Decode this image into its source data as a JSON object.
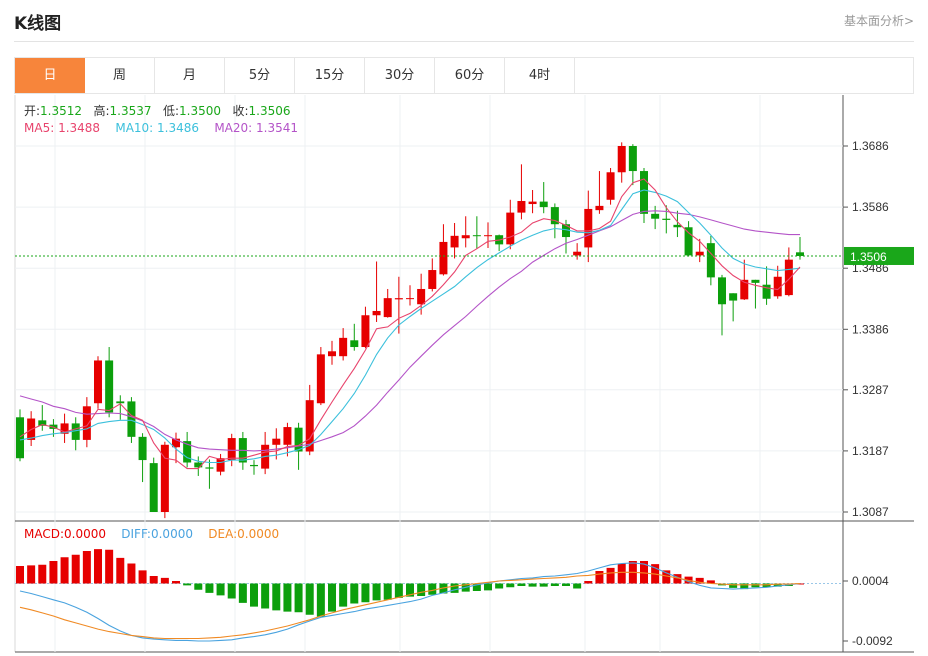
{
  "header": {
    "title": "K线图",
    "analysis_link": "基本面分析>"
  },
  "tabs": [
    {
      "label": "日",
      "active": true
    },
    {
      "label": "周"
    },
    {
      "label": "月"
    },
    {
      "label": "5分"
    },
    {
      "label": "15分"
    },
    {
      "label": "30分"
    },
    {
      "label": "60分"
    },
    {
      "label": "4时"
    }
  ],
  "ohlc_legend": {
    "open_label": "开:",
    "open": "1.3512",
    "high_label": "高:",
    "high": "1.3537",
    "low_label": "低:",
    "low": "1.3500",
    "close_label": "收:",
    "close": "1.3506"
  },
  "ma_legend": {
    "ma5_label": "MA5:",
    "ma5": "1.3488",
    "ma10_label": "MA10:",
    "ma10": "1.3486",
    "ma20_label": "MA20:",
    "ma20": "1.3541"
  },
  "macd_legend": {
    "macd_label": "MACD:",
    "macd": "0.0000",
    "diff_label": "DIFF:",
    "diff": "0.0000",
    "dea_label": "DEA:",
    "dea": "0.0000"
  },
  "colors": {
    "up": "#e60000",
    "down": "#0c9f0c",
    "ma5": "#e8446d",
    "ma10": "#3cc0dc",
    "ma20": "#b454c8",
    "diff": "#4aa3df",
    "dea": "#f08a24",
    "current": "#1aa71a",
    "accent": "#f7853b"
  },
  "chart_data": {
    "type": "candlestick",
    "price_axis": {
      "ticks": [
        "1.3686",
        "1.3586",
        "1.3486",
        "1.3386",
        "1.3287",
        "1.3187",
        "1.3087"
      ],
      "ylim": [
        1.3087,
        1.3686
      ]
    },
    "current_price": "1.3506",
    "candles": [
      [
        1.3242,
        1.3175,
        1.3255,
        1.317
      ],
      [
        1.3205,
        1.324,
        1.3252,
        1.3195
      ],
      [
        1.3237,
        1.3228,
        1.3262,
        1.322
      ],
      [
        1.323,
        1.3223,
        1.3239,
        1.321
      ],
      [
        1.3215,
        1.3232,
        1.3248,
        1.32
      ],
      [
        1.3232,
        1.3205,
        1.3242,
        1.3188
      ],
      [
        1.3205,
        1.326,
        1.3275,
        1.3193
      ],
      [
        1.3265,
        1.3335,
        1.3342,
        1.3256
      ],
      [
        1.3335,
        1.325,
        1.3357,
        1.3242
      ],
      [
        1.3268,
        1.3265,
        1.3278,
        1.3238
      ],
      [
        1.3268,
        1.321,
        1.3275,
        1.32
      ],
      [
        1.321,
        1.3172,
        1.3216,
        1.3136
      ],
      [
        1.3167,
        1.3087,
        1.3176,
        1.3087
      ],
      [
        1.3087,
        1.3197,
        1.3202,
        1.3077
      ],
      [
        1.3193,
        1.3207,
        1.3217,
        1.3167
      ],
      [
        1.3203,
        1.3168,
        1.3218,
        1.316
      ],
      [
        1.3168,
        1.316,
        1.3178,
        1.3146
      ],
      [
        1.316,
        1.3158,
        1.3173,
        1.3125
      ],
      [
        1.3153,
        1.3175,
        1.3182,
        1.3147
      ],
      [
        1.3172,
        1.3208,
        1.3215,
        1.3162
      ],
      [
        1.3208,
        1.3168,
        1.3218,
        1.3156
      ],
      [
        1.3164,
        1.3162,
        1.3172,
        1.3148
      ],
      [
        1.3158,
        1.3197,
        1.3218,
        1.3149
      ],
      [
        1.3197,
        1.3207,
        1.3224,
        1.3173
      ],
      [
        1.3197,
        1.3226,
        1.3233,
        1.3178
      ],
      [
        1.3225,
        1.3186,
        1.3233,
        1.3156
      ],
      [
        1.3186,
        1.327,
        1.3295,
        1.318
      ],
      [
        1.3265,
        1.3345,
        1.3357,
        1.3262
      ],
      [
        1.3342,
        1.335,
        1.3367,
        1.3328
      ],
      [
        1.3342,
        1.3372,
        1.3388,
        1.3335
      ],
      [
        1.3368,
        1.3357,
        1.3395,
        1.3351
      ],
      [
        1.3357,
        1.3409,
        1.3423,
        1.3355
      ],
      [
        1.3409,
        1.3416,
        1.3497,
        1.3398
      ],
      [
        1.3406,
        1.3437,
        1.3452,
        1.3405
      ],
      [
        1.3435,
        1.3437,
        1.3472,
        1.3379
      ],
      [
        1.3437,
        1.3437,
        1.3458,
        1.3425
      ],
      [
        1.3427,
        1.3452,
        1.3477,
        1.341
      ],
      [
        1.3452,
        1.3483,
        1.3502,
        1.3448
      ],
      [
        1.3476,
        1.3529,
        1.3558,
        1.3474
      ],
      [
        1.352,
        1.3539,
        1.356,
        1.3502
      ],
      [
        1.3535,
        1.354,
        1.3571,
        1.352
      ],
      [
        1.354,
        1.3539,
        1.3571,
        1.3518
      ],
      [
        1.3539,
        1.354,
        1.3561,
        1.3519
      ],
      [
        1.354,
        1.3525,
        1.3541,
        1.3514
      ],
      [
        1.3525,
        1.3577,
        1.3598,
        1.3517
      ],
      [
        1.3577,
        1.3596,
        1.3656,
        1.3566
      ],
      [
        1.3591,
        1.3595,
        1.3614,
        1.3576
      ],
      [
        1.3595,
        1.3586,
        1.3627,
        1.3576
      ],
      [
        1.3586,
        1.3558,
        1.3592,
        1.3535
      ],
      [
        1.3558,
        1.3537,
        1.3565,
        1.351
      ],
      [
        1.3507,
        1.3513,
        1.3527,
        1.35
      ],
      [
        1.352,
        1.3583,
        1.3613,
        1.3496
      ],
      [
        1.3581,
        1.3588,
        1.3645,
        1.3575
      ],
      [
        1.3598,
        1.3643,
        1.365,
        1.359
      ],
      [
        1.3643,
        1.3686,
        1.3692,
        1.3626
      ],
      [
        1.3686,
        1.3645,
        1.3689,
        1.3622
      ],
      [
        1.3645,
        1.3575,
        1.365,
        1.356
      ],
      [
        1.3575,
        1.3567,
        1.3588,
        1.355
      ],
      [
        1.3567,
        1.3565,
        1.3589,
        1.3543
      ],
      [
        1.3557,
        1.3553,
        1.358,
        1.3537
      ],
      [
        1.3553,
        1.3507,
        1.3563,
        1.3505
      ],
      [
        1.3507,
        1.3513,
        1.3534,
        1.3496
      ],
      [
        1.3527,
        1.3471,
        1.3539,
        1.3458
      ],
      [
        1.3471,
        1.3427,
        1.3475,
        1.3376
      ],
      [
        1.3445,
        1.3433,
        1.3445,
        1.3399
      ],
      [
        1.3435,
        1.3467,
        1.35,
        1.3434
      ],
      [
        1.3467,
        1.3462,
        1.3467,
        1.342
      ],
      [
        1.3459,
        1.3436,
        1.3489,
        1.3426
      ],
      [
        1.344,
        1.3472,
        1.349,
        1.3436
      ],
      [
        1.3442,
        1.35,
        1.352,
        1.344
      ],
      [
        1.3512,
        1.3506,
        1.3537,
        1.35
      ]
    ],
    "ma5": [
      1.321,
      1.3222,
      1.323,
      1.3226,
      1.3218,
      1.3223,
      1.3228,
      1.3255,
      1.3253,
      1.3264,
      1.3245,
      1.3237,
      1.32,
      1.3175,
      1.3172,
      1.3158,
      1.3158,
      1.3178,
      1.3173,
      1.3175,
      1.3175,
      1.318,
      1.3185,
      1.3187,
      1.3194,
      1.3196,
      1.3207,
      1.3238,
      1.3267,
      1.3295,
      1.3322,
      1.3352,
      1.3387,
      1.339,
      1.3404,
      1.3412,
      1.3425,
      1.344,
      1.3459,
      1.348,
      1.3507,
      1.3518,
      1.353,
      1.3532,
      1.3537,
      1.3545,
      1.356,
      1.3567,
      1.3564,
      1.3556,
      1.3547,
      1.3547,
      1.3551,
      1.3563,
      1.3603,
      1.3626,
      1.3632,
      1.3614,
      1.3585,
      1.3562,
      1.3544,
      1.353,
      1.351,
      1.349,
      1.3474,
      1.3463,
      1.3458,
      1.3454,
      1.3451,
      1.3468,
      1.3488
    ],
    "ma10": [
      1.3205,
      1.3208,
      1.3212,
      1.3215,
      1.3217,
      1.322,
      1.3223,
      1.3232,
      1.3235,
      1.3237,
      1.3237,
      1.323,
      1.3222,
      1.3208,
      1.319,
      1.3176,
      1.317,
      1.3168,
      1.3168,
      1.3172,
      1.3172,
      1.3174,
      1.3178,
      1.318,
      1.3184,
      1.3189,
      1.3196,
      1.3214,
      1.3235,
      1.3256,
      1.3281,
      1.3311,
      1.3345,
      1.3372,
      1.3393,
      1.3407,
      1.342,
      1.3432,
      1.3444,
      1.3456,
      1.3472,
      1.3487,
      1.35,
      1.3511,
      1.3522,
      1.3532,
      1.354,
      1.3547,
      1.3551,
      1.3549,
      1.3545,
      1.3544,
      1.3548,
      1.3556,
      1.3582,
      1.3608,
      1.3614,
      1.361,
      1.3604,
      1.3595,
      1.3577,
      1.356,
      1.354,
      1.3519,
      1.3502,
      1.3493,
      1.3488,
      1.3485,
      1.3482,
      1.3484,
      1.3486
    ],
    "ma20": [
      1.3277,
      1.3272,
      1.3267,
      1.326,
      1.3256,
      1.325,
      1.3247,
      1.3248,
      1.3249,
      1.3248,
      1.3243,
      1.3236,
      1.3227,
      1.3214,
      1.3205,
      1.3198,
      1.3192,
      1.319,
      1.3189,
      1.3188,
      1.3188,
      1.3187,
      1.3188,
      1.319,
      1.3192,
      1.3195,
      1.3198,
      1.3204,
      1.321,
      1.3217,
      1.3228,
      1.3244,
      1.3262,
      1.3283,
      1.3303,
      1.3324,
      1.3342,
      1.336,
      1.3377,
      1.3392,
      1.3407,
      1.3424,
      1.344,
      1.3455,
      1.3469,
      1.3481,
      1.3496,
      1.3507,
      1.3518,
      1.3527,
      1.3533,
      1.354,
      1.3547,
      1.3554,
      1.3564,
      1.3574,
      1.3579,
      1.358,
      1.3579,
      1.3576,
      1.3574,
      1.357,
      1.3565,
      1.356,
      1.3555,
      1.355,
      1.3547,
      1.3545,
      1.3543,
      1.3541,
      1.3541
    ],
    "macd_axis": {
      "ticks": [
        "0.0004",
        "-0.0092"
      ],
      "ylim": [
        -0.0092,
        0.0004
      ]
    },
    "macd_hist": [
      0.0028,
      0.0029,
      0.003,
      0.0036,
      0.0042,
      0.0046,
      0.0052,
      0.0055,
      0.0054,
      0.0041,
      0.0032,
      0.0021,
      0.0012,
      0.0009,
      0.0004,
      -0.0003,
      -0.001,
      -0.0015,
      -0.0019,
      -0.0024,
      -0.0031,
      -0.0037,
      -0.004,
      -0.0043,
      -0.0045,
      -0.0046,
      -0.005,
      -0.0053,
      -0.0045,
      -0.0037,
      -0.0032,
      -0.003,
      -0.0027,
      -0.0026,
      -0.0023,
      -0.0021,
      -0.002,
      -0.0018,
      -0.0016,
      -0.0015,
      -0.0013,
      -0.0012,
      -0.0011,
      -0.0008,
      -0.0006,
      -0.0004,
      -0.0005,
      -0.0005,
      -0.0004,
      -0.0004,
      -0.0008,
      0.0004,
      0.002,
      0.0025,
      0.0032,
      0.0036,
      0.0036,
      0.0031,
      0.0021,
      0.0015,
      0.0011,
      0.0009,
      0.0005,
      -0.0003,
      -0.0007,
      -0.0009,
      -0.0006,
      -0.0006,
      -0.0005,
      -0.0004,
      0.0
    ],
    "diff": [
      -0.0012,
      -0.0016,
      -0.0021,
      -0.0026,
      -0.0031,
      -0.0038,
      -0.0046,
      -0.0056,
      -0.0067,
      -0.0076,
      -0.0083,
      -0.0087,
      -0.0089,
      -0.009,
      -0.0091,
      -0.0091,
      -0.0092,
      -0.0092,
      -0.0091,
      -0.009,
      -0.0087,
      -0.0085,
      -0.0082,
      -0.0078,
      -0.0073,
      -0.0066,
      -0.006,
      -0.0054,
      -0.0051,
      -0.0048,
      -0.0045,
      -0.0041,
      -0.0038,
      -0.0035,
      -0.0032,
      -0.0029,
      -0.0025,
      -0.0019,
      -0.0015,
      -0.001,
      -0.0006,
      -0.0002,
      0.0001,
      0.0004,
      0.0006,
      0.0008,
      0.0009,
      0.0011,
      0.0012,
      0.0014,
      0.0016,
      0.002,
      0.0025,
      0.003,
      0.0032,
      0.0033,
      0.0031,
      0.0025,
      0.0017,
      0.001,
      0.0003,
      -0.0003,
      -0.0007,
      -0.0008,
      -0.0009,
      -0.0008,
      -0.0007,
      -0.0006,
      -0.0004,
      -0.0002,
      0.0
    ],
    "dea": [
      -0.0038,
      -0.0042,
      -0.0047,
      -0.0052,
      -0.0058,
      -0.0063,
      -0.0068,
      -0.0073,
      -0.0077,
      -0.008,
      -0.0083,
      -0.0085,
      -0.0087,
      -0.0088,
      -0.0088,
      -0.0088,
      -0.0088,
      -0.0087,
      -0.0086,
      -0.0084,
      -0.0082,
      -0.0079,
      -0.0076,
      -0.0072,
      -0.0068,
      -0.0063,
      -0.0058,
      -0.0052,
      -0.0047,
      -0.0042,
      -0.0038,
      -0.0034,
      -0.003,
      -0.0026,
      -0.0022,
      -0.0018,
      -0.0014,
      -0.0011,
      -0.0007,
      -0.0004,
      -0.0002,
      0.0,
      0.0002,
      0.0004,
      0.0005,
      0.0006,
      0.0007,
      0.0008,
      0.0009,
      0.001,
      0.0012,
      0.0013,
      0.0015,
      0.0017,
      0.0018,
      0.0018,
      0.0017,
      0.0015,
      0.0012,
      0.0009,
      0.0005,
      0.0002,
      0.0,
      -0.0001,
      -0.0002,
      -0.0002,
      -0.0002,
      -0.0002,
      -0.0001,
      -0.0001,
      0.0
    ]
  }
}
